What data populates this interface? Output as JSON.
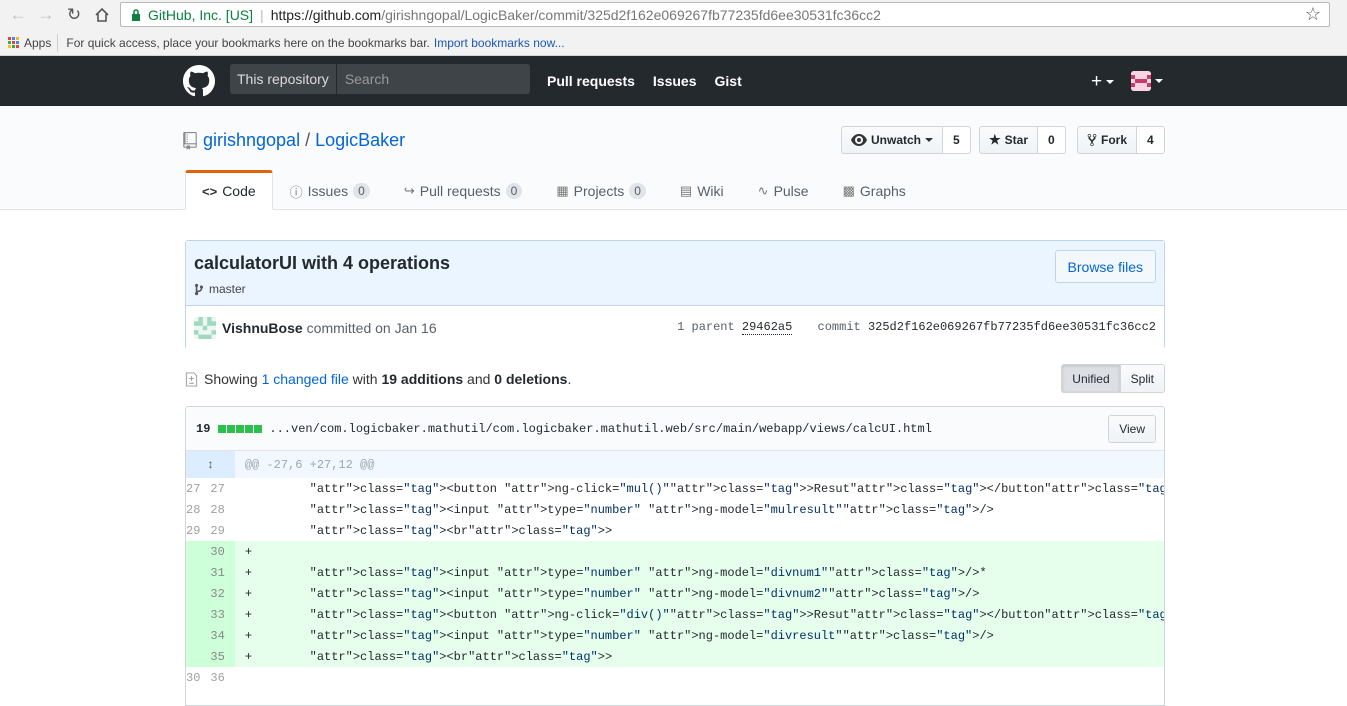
{
  "browser": {
    "secure_label": "GitHub, Inc. [US]",
    "url_host": "https://github.com",
    "url_path": "/girishngopal/LogicBaker/commit/325d2f162e069267fb77235fd6ee30531fc36cc2",
    "bookmarks": {
      "apps_label": "Apps",
      "hint": "For quick access, place your bookmarks here on the bookmarks bar.",
      "import_link": "Import bookmarks now..."
    }
  },
  "header": {
    "search_scope": "This repository",
    "search_placeholder": "Search",
    "nav": [
      "Pull requests",
      "Issues",
      "Gist"
    ],
    "plus_label": "+"
  },
  "repo": {
    "owner": "girishngopal",
    "name": "LogicBaker",
    "watch_label": "Unwatch",
    "watch_count": "5",
    "star_label": "Star",
    "star_count": "0",
    "fork_label": "Fork",
    "fork_count": "4",
    "tabs": [
      {
        "label": "Code",
        "count": ""
      },
      {
        "label": "Issues",
        "count": "0"
      },
      {
        "label": "Pull requests",
        "count": "0"
      },
      {
        "label": "Projects",
        "count": "0"
      },
      {
        "label": "Wiki",
        "count": ""
      },
      {
        "label": "Pulse",
        "count": ""
      },
      {
        "label": "Graphs",
        "count": ""
      }
    ]
  },
  "commit": {
    "title": "calculatorUI with 4 operations",
    "branch": "master",
    "browse_label": "Browse files",
    "author": "VishnuBose",
    "committed_text": "committed on Jan 16",
    "parent_label": "1 parent",
    "parent_sha": "29462a5",
    "commit_label": "commit",
    "sha": "325d2f162e069267fb77235fd6ee30531fc36cc2"
  },
  "toc": {
    "showing": "Showing",
    "changed_link": "1 changed file",
    "with": "with",
    "additions": "19 additions",
    "and": "and",
    "deletions": "0 deletions",
    "period": ".",
    "unified_label": "Unified",
    "split_label": "Split"
  },
  "file": {
    "stat_count": "19",
    "path": "...ven/com.logicbaker.mathutil/com.logicbaker.mathutil.web/src/main/webapp/views/calcUI.html",
    "view_label": "View",
    "hunk_header": "@@ -27,6 +27,12 @@",
    "lines": [
      {
        "type": "ctx",
        "old": "27",
        "new": "27",
        "sign": " ",
        "code": "    <button ng-click=\"mul()\">Resut</button>"
      },
      {
        "type": "ctx",
        "old": "28",
        "new": "28",
        "sign": " ",
        "code": "    <input type=\"number\" ng-model=\"mulresult\"/>"
      },
      {
        "type": "ctx",
        "old": "29",
        "new": "29",
        "sign": " ",
        "code": "    <br>"
      },
      {
        "type": "add",
        "old": "",
        "new": "30",
        "sign": "+",
        "code": ""
      },
      {
        "type": "add",
        "old": "",
        "new": "31",
        "sign": "+",
        "code": "    <input type=\"number\" ng-model=\"divnum1\"/>*"
      },
      {
        "type": "add",
        "old": "",
        "new": "32",
        "sign": "+",
        "code": "    <input type=\"number\" ng-model=\"divnum2\"/>"
      },
      {
        "type": "add",
        "old": "",
        "new": "33",
        "sign": "+",
        "code": "    <button ng-click=\"div()\">Resut</button>"
      },
      {
        "type": "add",
        "old": "",
        "new": "34",
        "sign": "+",
        "code": "    <input type=\"number\" ng-model=\"divresult\"/>"
      },
      {
        "type": "add",
        "old": "",
        "new": "35",
        "sign": "+",
        "code": "    <br>"
      },
      {
        "type": "ctx",
        "old": "30",
        "new": "36",
        "sign": " ",
        "code": ""
      }
    ]
  }
}
